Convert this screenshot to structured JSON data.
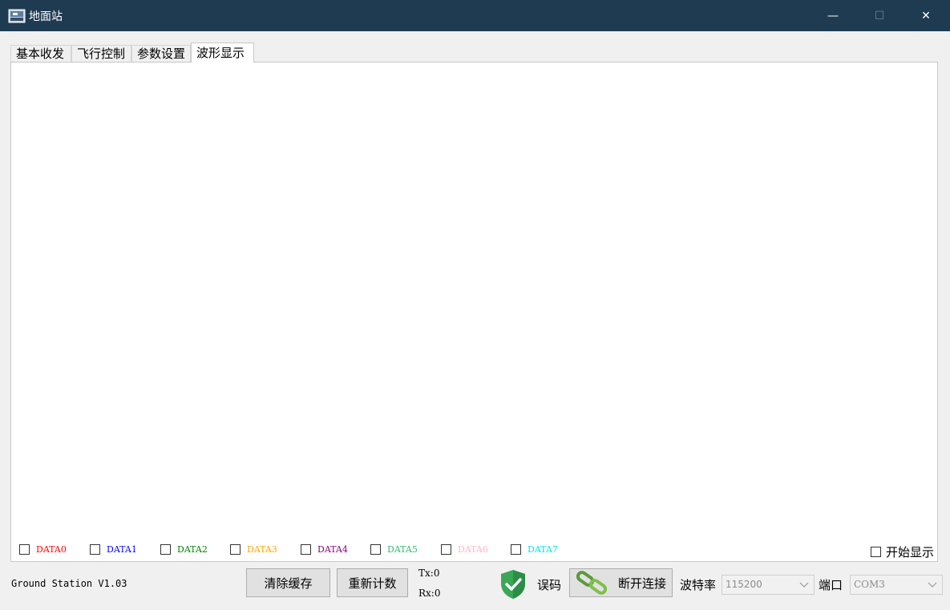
{
  "window": {
    "title": "地面站",
    "minimize": "—",
    "maximize": "☐",
    "close": "✕"
  },
  "tabs": [
    {
      "label": "基本收发"
    },
    {
      "label": "飞行控制"
    },
    {
      "label": "参数设置"
    },
    {
      "label": "波形显示",
      "active": true
    }
  ],
  "channels": [
    {
      "label": "DATA0",
      "color": "#ff0000"
    },
    {
      "label": "DATA1",
      "color": "#0000ff"
    },
    {
      "label": "DATA2",
      "color": "#008000"
    },
    {
      "label": "DATA3",
      "color": "#ffa500"
    },
    {
      "label": "DATA4",
      "color": "#800080"
    },
    {
      "label": "DATA5",
      "color": "#2eb872"
    },
    {
      "label": "DATA6",
      "color": "#ffb6c1"
    },
    {
      "label": "DATA7",
      "color": "#00e5ee"
    }
  ],
  "start_display": "开始显示",
  "status": {
    "version": "Ground Station V1.03",
    "clear_cache": "清除缓存",
    "reset_count": "重新计数",
    "tx": "Tx:0",
    "rx": "Rx:0",
    "error_code": "误码",
    "disconnect": "断开连接",
    "baud_label": "波特率",
    "baud_value": "115200",
    "port_label": "端口",
    "port_value": "COM3"
  }
}
